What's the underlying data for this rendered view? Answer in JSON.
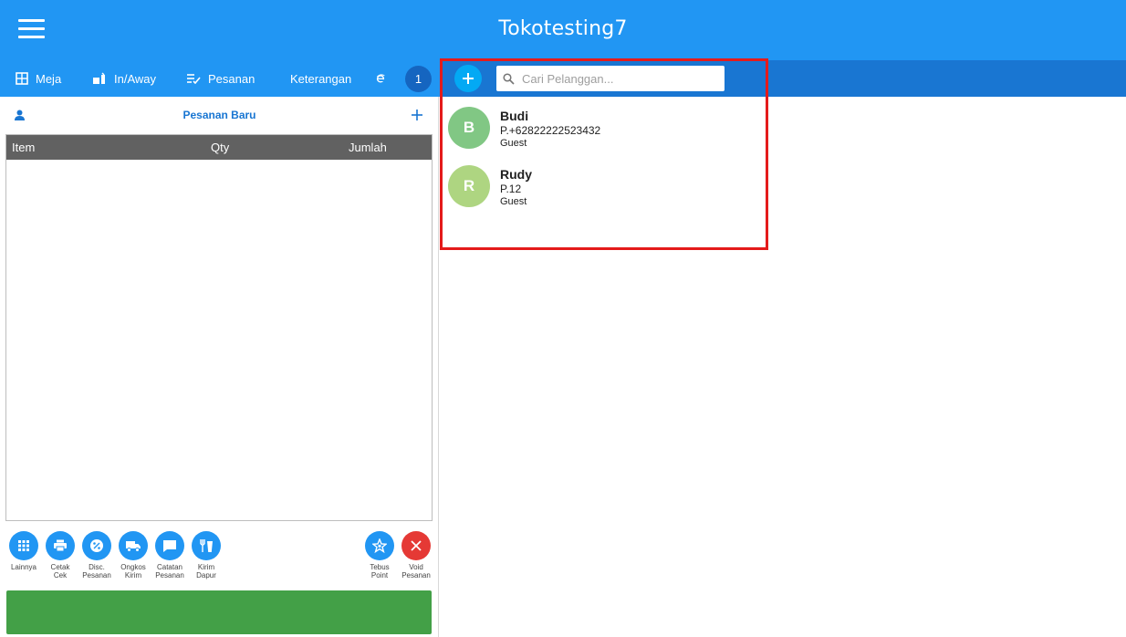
{
  "app": {
    "title": "Tokotesting7"
  },
  "nav": {
    "meja": "Meja",
    "in_away": "In/Away",
    "pesanan": "Pesanan",
    "keterangan": "Keterangan",
    "badge_count": "1"
  },
  "order": {
    "title": "Pesanan Baru",
    "columns": {
      "item": "Item",
      "qty": "Qty",
      "jumlah": "Jumlah"
    }
  },
  "actions": [
    {
      "line1": "Lainnya",
      "line2": ""
    },
    {
      "line1": "Cetak",
      "line2": "Cek"
    },
    {
      "line1": "Disc.",
      "line2": "Pesanan"
    },
    {
      "line1": "Ongkos",
      "line2": "Kirim"
    },
    {
      "line1": "Catatan",
      "line2": "Pesanan"
    },
    {
      "line1": "Kirim",
      "line2": "Dapur"
    },
    {
      "line1": "Tebus",
      "line2": "Point"
    },
    {
      "line1": "Void",
      "line2": "Pesanan"
    }
  ],
  "search": {
    "placeholder": "Cari Pelanggan..."
  },
  "customers": [
    {
      "initial": "B",
      "name": "Budi",
      "phone": "P.+62822222523432",
      "type": "Guest",
      "color": "#81c784"
    },
    {
      "initial": "R",
      "name": "Rudy",
      "phone": "P.12",
      "type": "Guest",
      "color": "#aed581"
    }
  ],
  "colors": {
    "primary": "#2196f3",
    "primary_dark": "#1976d2",
    "accent_add": "#03a9f4",
    "success": "#43a047",
    "danger": "#e53935",
    "highlight": "#e41b1b"
  }
}
